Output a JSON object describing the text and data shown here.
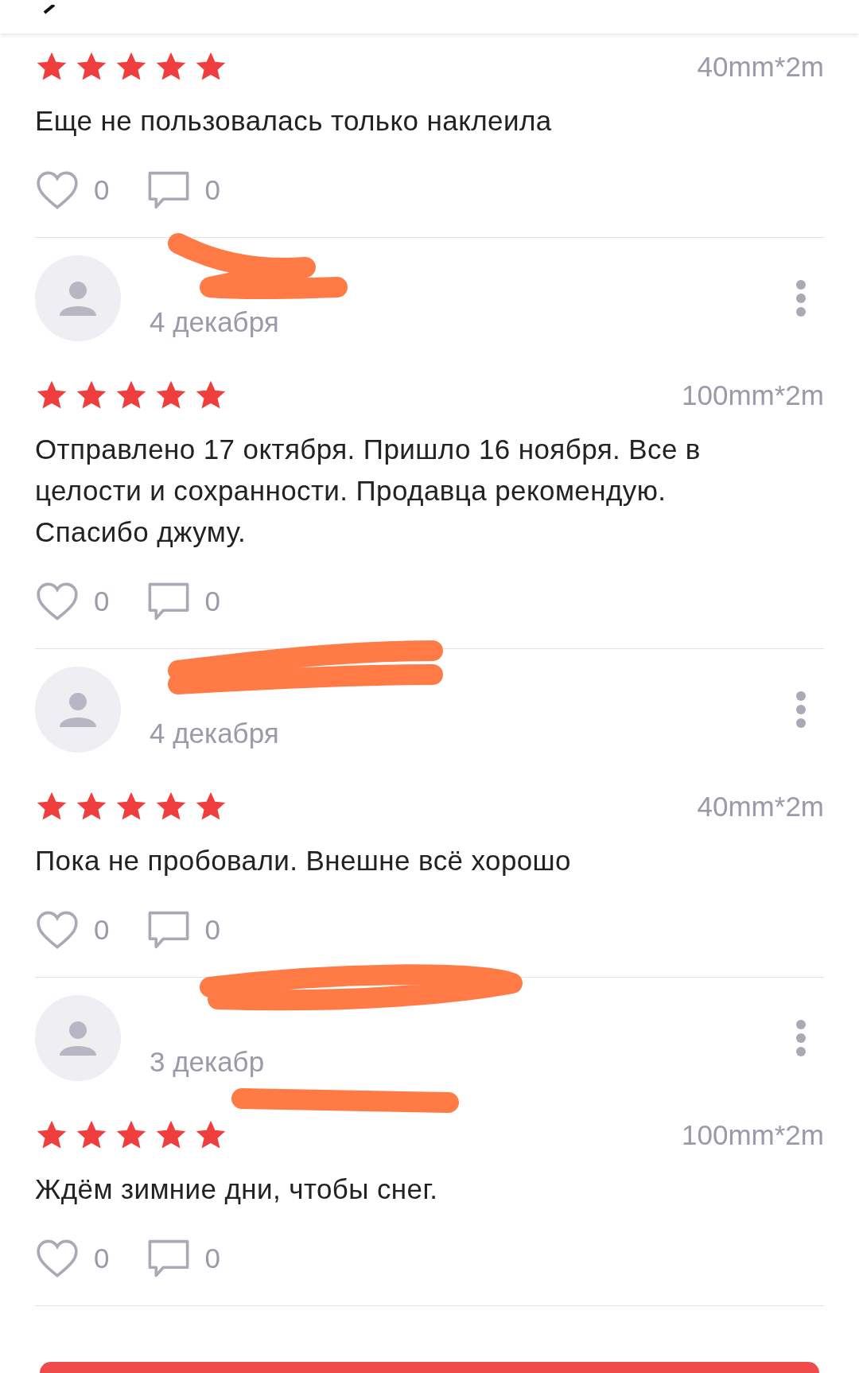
{
  "reviews": [
    {
      "stars": 5,
      "size": "40mm*2m",
      "text": "Еще не пользовалась только наклеила",
      "likes": "0",
      "comments": "0"
    },
    {
      "date": "4 декабря",
      "stars": 5,
      "size": "100mm*2m",
      "text": "Отправлено 17 октября. Пришло 16 ноября. Все в целости и сохранности. Продавца рекомендую. Спасибо джуму.",
      "likes": "0",
      "comments": "0"
    },
    {
      "date": "4 декабря",
      "stars": 5,
      "size": "40mm*2m",
      "text": "Пока не пробовали. Внешне всё хорошо",
      "likes": "0",
      "comments": "0"
    },
    {
      "date": "3 декабр",
      "stars": 5,
      "size": "100mm*2m",
      "text": "Ждём зимние дни, чтобы снег.",
      "likes": "0",
      "comments": "0"
    }
  ]
}
